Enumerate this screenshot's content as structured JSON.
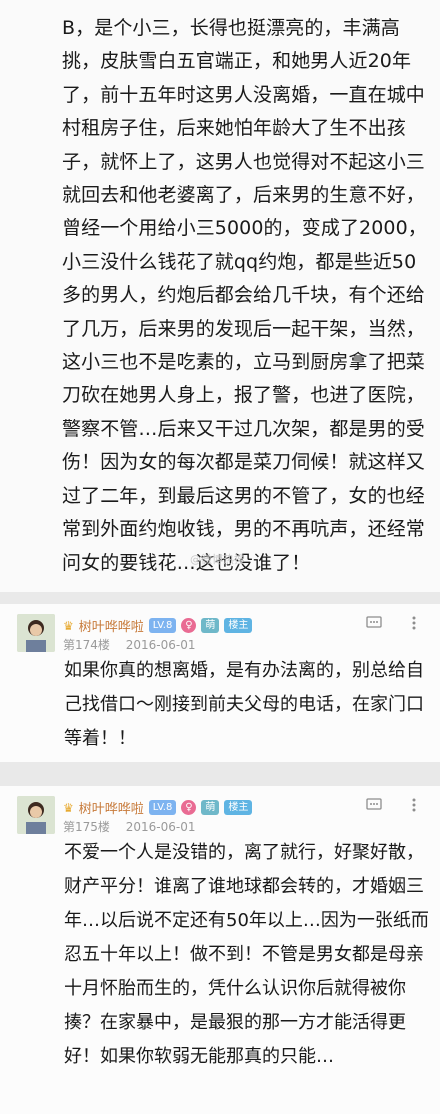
{
  "post": {
    "text": "B，是个小三，长得也挺漂亮的，丰满高挑，皮肤雪白五官端正，和她男人近20年了，前十五年时这男人没离婚，一直在城中村租房子住，后来她怕年龄大了生不出孩子，就怀上了，这男人也觉得对不起这小三就回去和他老婆离了，后来男的生意不好，曾经一个用给小三5000的，变成了2000，小三没什么钱花了就qq约炮，都是些近50多的男人，约炮后都会给几千块，有个还给了几万，后来男的发现后一起干架，当然，这小三也不是吃素的，立马到厨房拿了把菜刀砍在她男人身上，报了警，也进了医院，警察不管…后来又干过几次架，都是男的受伤！因为女的每次都是菜刀伺候！就这样又过了二年，到最后这男的不管了，女的也经常到外面约炮收钱，男的不再吭声，还经常问女的要钱花…这也没谁了！",
    "watermark": "@微博热搜"
  },
  "replies": [
    {
      "username": "树叶哗哗啦",
      "level": "LV.8",
      "badge_vip": "萌",
      "badge_owner": "楼主",
      "floor": "第174楼",
      "date": "2016-06-01",
      "text": "如果你真的想离婚，是有办法离的，别总给自己找借口～刚接到前夫父母的电话，在家门口等着！！"
    },
    {
      "username": "树叶哗哗啦",
      "level": "LV.8",
      "badge_vip": "萌",
      "badge_owner": "楼主",
      "floor": "第175楼",
      "date": "2016-06-01",
      "text": "不爱一个人是没错的，离了就行，好聚好散，财产平分！谁离了谁地球都会转的，才婚姻三年…以后说不定还有50年以上…因为一张纸而忍五十年以上！做不到！不管是男女都是母亲十月怀胎而生的，凭什么认识你后就得被你揍？在家暴中，是最狠的那一方才能活得更好！如果你软弱无能那真的只能…"
    }
  ],
  "icons": {
    "comment": "comment-icon",
    "more": "more-vertical-icon",
    "gender": "female-icon",
    "crown": "crown-icon"
  },
  "colors": {
    "username": "#c77a3a",
    "level_badge": "#7db3f0",
    "gender_badge": "#e96b93",
    "owner_badge": "#5fb4e3"
  }
}
